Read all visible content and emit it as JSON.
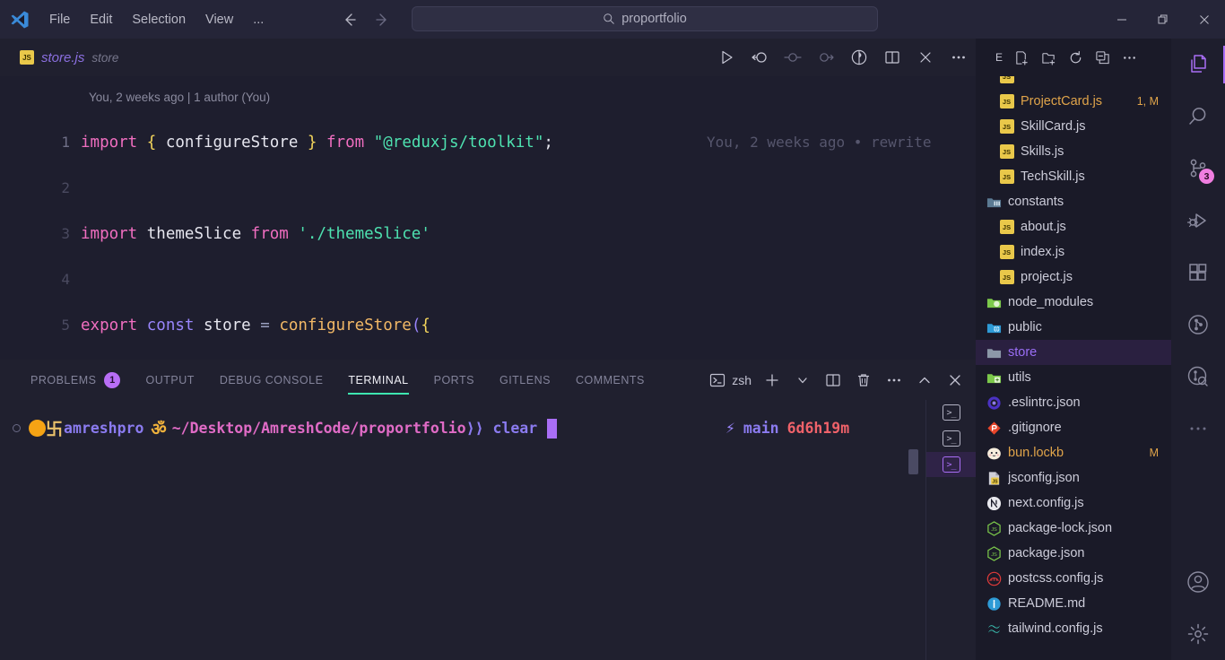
{
  "window": {
    "app": "Visual Studio Code",
    "menu": [
      "File",
      "Edit",
      "Selection",
      "View",
      "..."
    ],
    "search_value": "proportfolio",
    "search_icon": "search-icon",
    "back_icon": "arrow-left-icon",
    "forward_icon": "arrow-right-icon",
    "controls": {
      "minimize": "minimize-icon",
      "maximize": "restore-icon",
      "close": "close-icon"
    }
  },
  "editor_tab": {
    "file_icon": "JS",
    "filename": "store.js",
    "directory": "store"
  },
  "editor_actions": [
    {
      "name": "run-button",
      "icon": "play-icon"
    },
    {
      "name": "step-back-button",
      "icon": "step-back-icon"
    },
    {
      "name": "breakpoint-button",
      "icon": "circle-line-icon"
    },
    {
      "name": "step-over-button",
      "icon": "step-over-icon"
    },
    {
      "name": "git-lens-button",
      "icon": "blame-icon"
    },
    {
      "name": "split-editor-button",
      "icon": "split-icon"
    },
    {
      "name": "close-editor-button",
      "icon": "close-icon"
    },
    {
      "name": "more-actions-button",
      "icon": "ellipsis-icon"
    }
  ],
  "editor": {
    "blame_header": "You, 2 weeks ago | 1 author (You)",
    "inline_blame": "You, 2 weeks ago • rewrite",
    "lines": [
      {
        "number": "1",
        "tokens": [
          {
            "t": "import",
            "c": "k-kw"
          },
          {
            "t": " ",
            "c": "k-var"
          },
          {
            "t": "{",
            "c": "k-brc"
          },
          {
            "t": " ",
            "c": "k-var"
          },
          {
            "t": "configureStore",
            "c": "k-var"
          },
          {
            "t": " ",
            "c": "k-var"
          },
          {
            "t": "}",
            "c": "k-brc"
          },
          {
            "t": " ",
            "c": "k-var"
          },
          {
            "t": "from",
            "c": "k-kw"
          },
          {
            "t": " ",
            "c": "k-var"
          },
          {
            "t": "\"@reduxjs/toolkit\"",
            "c": "k-str"
          },
          {
            "t": ";",
            "c": "k-punct"
          }
        ]
      },
      {
        "number": "2",
        "dim": true,
        "tokens": []
      },
      {
        "number": "3",
        "dim": true,
        "tokens": [
          {
            "t": "import",
            "c": "k-kw"
          },
          {
            "t": " ",
            "c": "k-var"
          },
          {
            "t": "themeSlice",
            "c": "k-var"
          },
          {
            "t": " ",
            "c": "k-var"
          },
          {
            "t": "from",
            "c": "k-kw"
          },
          {
            "t": " ",
            "c": "k-var"
          },
          {
            "t": "'./themeSlice'",
            "c": "k-str"
          }
        ]
      },
      {
        "number": "4",
        "dim": true,
        "tokens": []
      },
      {
        "number": "5",
        "dim": true,
        "tokens": [
          {
            "t": "export",
            "c": "k-kw"
          },
          {
            "t": " ",
            "c": "k-var"
          },
          {
            "t": "const",
            "c": "k-kw2"
          },
          {
            "t": " ",
            "c": "k-var"
          },
          {
            "t": "store",
            "c": "k-var"
          },
          {
            "t": " ",
            "c": "k-var"
          },
          {
            "t": "=",
            "c": "k-op"
          },
          {
            "t": " ",
            "c": "k-var"
          },
          {
            "t": "configureStore",
            "c": "k-fn"
          },
          {
            "t": "(",
            "c": "k-kw2"
          },
          {
            "t": "{",
            "c": "k-brc"
          }
        ]
      }
    ]
  },
  "panel": {
    "tabs": [
      {
        "label": "PROBLEMS",
        "badge": "1",
        "active": false
      },
      {
        "label": "OUTPUT",
        "active": false
      },
      {
        "label": "DEBUG CONSOLE",
        "active": false
      },
      {
        "label": "TERMINAL",
        "active": true
      },
      {
        "label": "PORTS",
        "active": false
      },
      {
        "label": "GITLENS",
        "active": false
      },
      {
        "label": "COMMENTS",
        "active": false
      }
    ],
    "shell_label": "zsh",
    "shell_icon": "terminal-icon",
    "actions": [
      {
        "name": "new-terminal-button",
        "icon": "plus-icon"
      },
      {
        "name": "terminal-profile-dropdown",
        "icon": "chevron-down-icon"
      },
      {
        "name": "split-terminal-button",
        "icon": "split-icon"
      },
      {
        "name": "kill-terminal-button",
        "icon": "trash-icon"
      },
      {
        "name": "panel-more-button",
        "icon": "ellipsis-icon"
      },
      {
        "name": "maximize-panel-button",
        "icon": "chevron-up-icon"
      },
      {
        "name": "close-panel-button",
        "icon": "close-icon"
      }
    ]
  },
  "terminal": {
    "prompt_user": "amreshpro",
    "prompt_glyph": "卐",
    "prompt_om": "ॐ",
    "path": "~/Desktop/AmreshCode/proportfolio",
    "arrow": "⟩⟩",
    "command": "clear",
    "branch_icon": "lightning-icon",
    "branch": "main",
    "duration": "6d6h19m",
    "side_tabs": [
      {
        "name": "terminal-tab-1",
        "active": false
      },
      {
        "name": "terminal-tab-2",
        "active": false
      },
      {
        "name": "terminal-tab-3",
        "active": true
      }
    ]
  },
  "explorer": {
    "header_label": "E",
    "actions": [
      {
        "name": "new-file-button",
        "icon": "new-file-icon"
      },
      {
        "name": "new-folder-button",
        "icon": "new-folder-icon"
      },
      {
        "name": "refresh-explorer-button",
        "icon": "refresh-icon"
      },
      {
        "name": "collapse-folders-button",
        "icon": "collapse-all-icon"
      },
      {
        "name": "explorer-more-button",
        "icon": "ellipsis-icon"
      }
    ],
    "files": [
      {
        "label": "ProjectCard.js",
        "icon": "js",
        "indent": true,
        "modified": true,
        "badge": "1, M"
      },
      {
        "label": "SkillCard.js",
        "icon": "js",
        "indent": true
      },
      {
        "label": "Skills.js",
        "icon": "js",
        "indent": true
      },
      {
        "label": "TechSkill.js",
        "icon": "js",
        "indent": true
      },
      {
        "label": "constants",
        "icon": "folder-constants"
      },
      {
        "label": "about.js",
        "icon": "js",
        "indent": true
      },
      {
        "label": "index.js",
        "icon": "js",
        "indent": true
      },
      {
        "label": "project.js",
        "icon": "js",
        "indent": true
      },
      {
        "label": "node_modules",
        "icon": "folder-node"
      },
      {
        "label": "public",
        "icon": "folder-public"
      },
      {
        "label": "store",
        "icon": "folder-plain",
        "selected": true
      },
      {
        "label": "utils",
        "icon": "folder-utils"
      },
      {
        "label": ".eslintrc.json",
        "icon": "eslint"
      },
      {
        "label": ".gitignore",
        "icon": "git"
      },
      {
        "label": "bun.lockb",
        "icon": "bun",
        "modified": true,
        "badge": "M"
      },
      {
        "label": "jsconfig.json",
        "icon": "jsconfig"
      },
      {
        "label": "next.config.js",
        "icon": "next"
      },
      {
        "label": "package-lock.json",
        "icon": "node"
      },
      {
        "label": "package.json",
        "icon": "node"
      },
      {
        "label": "postcss.config.js",
        "icon": "postcss"
      },
      {
        "label": "README.md",
        "icon": "info"
      },
      {
        "label": "tailwind.config.js",
        "icon": "tailwind"
      }
    ]
  },
  "activitybar": [
    {
      "name": "activity-explorer",
      "icon": "files-icon",
      "active": true
    },
    {
      "name": "activity-search",
      "icon": "search-icon",
      "active": false
    },
    {
      "name": "activity-source-control",
      "icon": "source-control-icon",
      "active": false,
      "badge": "3"
    },
    {
      "name": "activity-run-debug",
      "icon": "run-debug-icon",
      "active": false
    },
    {
      "name": "activity-extensions",
      "icon": "extensions-icon",
      "active": false
    },
    {
      "name": "activity-git-graph",
      "icon": "git-graph-icon",
      "active": false
    },
    {
      "name": "activity-git-search",
      "icon": "git-search-icon",
      "active": false
    },
    {
      "name": "activity-more",
      "icon": "ellipsis-icon",
      "active": false
    },
    {
      "name": "activity-accounts",
      "icon": "account-icon",
      "active": false
    },
    {
      "name": "activity-settings",
      "icon": "gear-icon",
      "active": false
    }
  ],
  "colors": {
    "accent": "#a96ef5",
    "terminal_green": "#3ee6b0",
    "badge_pink": "#f07ee0",
    "modified_orange": "#e0a44a"
  }
}
